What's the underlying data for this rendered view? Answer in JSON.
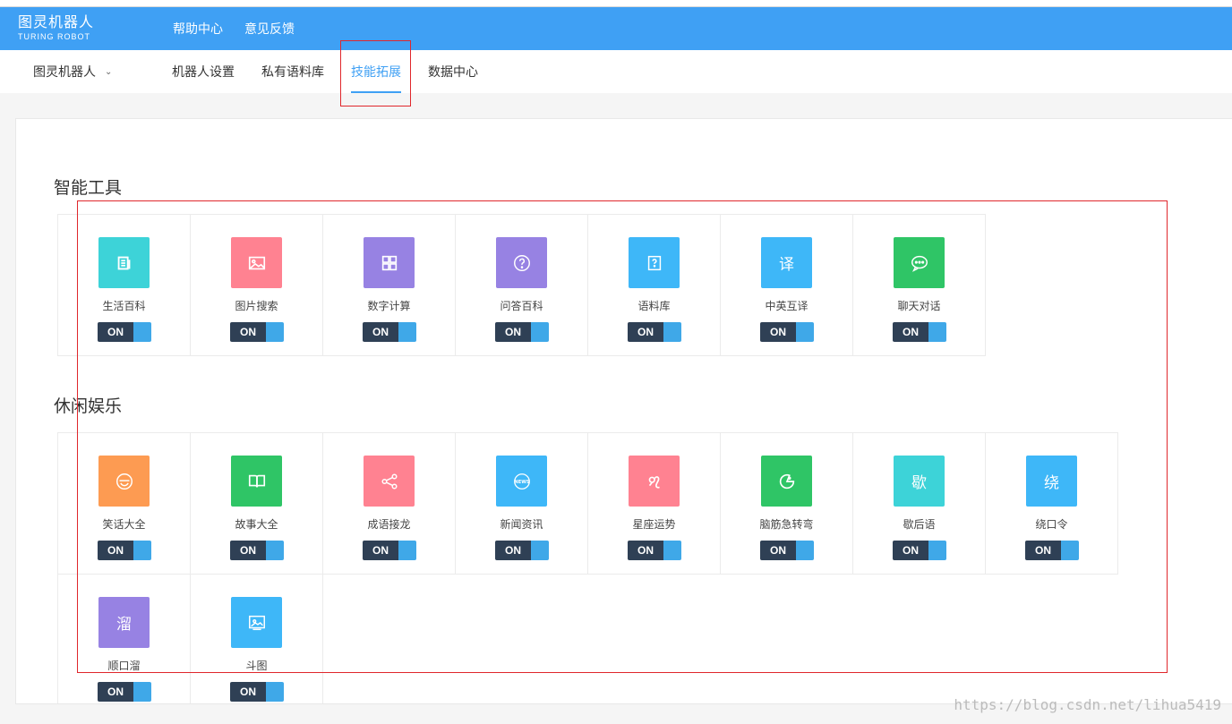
{
  "brand": {
    "name_cn": "图灵机器人",
    "name_en": "TURING ROBOT"
  },
  "top_nav": [
    {
      "label": "帮助中心"
    },
    {
      "label": "意见反馈"
    }
  ],
  "robot_selector": {
    "value": "图灵机器人"
  },
  "tabs": [
    {
      "label": "机器人设置",
      "active": false
    },
    {
      "label": "私有语料库",
      "active": false
    },
    {
      "label": "技能拓展",
      "active": true
    },
    {
      "label": "数据中心",
      "active": false
    }
  ],
  "sections": [
    {
      "title": "智能工具",
      "items": [
        {
          "label": "生活百科",
          "color": "#3dd3d8",
          "icon": "notes-icon",
          "toggle": "ON"
        },
        {
          "label": "图片搜索",
          "color": "#ff8291",
          "icon": "image-icon",
          "toggle": "ON"
        },
        {
          "label": "数字计算",
          "color": "#9782e3",
          "icon": "calculator-icon",
          "toggle": "ON"
        },
        {
          "label": "问答百科",
          "color": "#9782e3",
          "icon": "question-circle-icon",
          "toggle": "ON"
        },
        {
          "label": "语料库",
          "color": "#3eb7f8",
          "icon": "question-box-icon",
          "toggle": "ON"
        },
        {
          "label": "中英互译",
          "color": "#3eb7f8",
          "icon": "translate-icon",
          "glyph": "译",
          "toggle": "ON"
        },
        {
          "label": "聊天对话",
          "color": "#2fc566",
          "icon": "chat-icon",
          "toggle": "ON"
        }
      ]
    },
    {
      "title": "休闲娱乐",
      "items": [
        {
          "label": "笑话大全",
          "color": "#fd9b52",
          "icon": "laugh-icon",
          "toggle": "ON"
        },
        {
          "label": "故事大全",
          "color": "#2fc566",
          "icon": "book-icon",
          "toggle": "ON"
        },
        {
          "label": "成语接龙",
          "color": "#ff8291",
          "icon": "share-icon",
          "toggle": "ON"
        },
        {
          "label": "新闻资讯",
          "color": "#3eb7f8",
          "icon": "news-icon",
          "toggle": "ON"
        },
        {
          "label": "星座运势",
          "color": "#ff8291",
          "icon": "leo-icon",
          "toggle": "ON"
        },
        {
          "label": "脑筋急转弯",
          "color": "#2fc566",
          "icon": "brain-icon",
          "toggle": "ON"
        },
        {
          "label": "歇后语",
          "color": "#3dd3d8",
          "icon": "xiehouyu-icon",
          "glyph": "歇",
          "toggle": "ON"
        },
        {
          "label": "绕口令",
          "color": "#3eb7f8",
          "icon": "raokouling-icon",
          "glyph": "绕",
          "toggle": "ON"
        },
        {
          "label": "顺口溜",
          "color": "#9782e3",
          "icon": "shunkouliu-icon",
          "glyph": "溜",
          "toggle": "ON"
        },
        {
          "label": "斗图",
          "color": "#3eb7f8",
          "icon": "picture-frame-icon",
          "toggle": "ON"
        }
      ]
    }
  ],
  "watermark": "https://blog.csdn.net/lihua5419"
}
